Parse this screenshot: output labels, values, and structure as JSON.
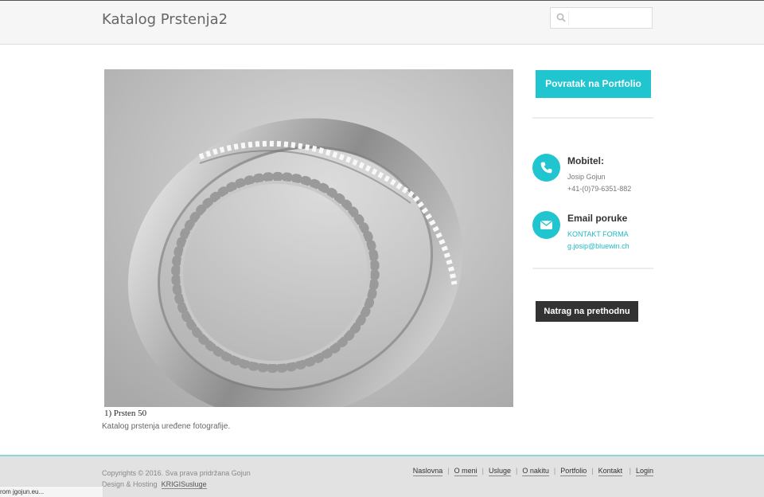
{
  "header": {
    "site_title": "Katalog Prstenja2",
    "search": {
      "placeholder": "",
      "value": "",
      "icon": "search-icon"
    }
  },
  "main": {
    "image_caption": "1) Prsten 50",
    "description": "Katalog prstenja uređene fotografije."
  },
  "sidebar": {
    "portfolio_button": "Povratak na Portfolio",
    "contacts": [
      {
        "icon": "phone-icon",
        "title": "Mobitel:",
        "lines": [
          "Josip Gojun",
          "+41-(0)79-6351-882"
        ]
      },
      {
        "icon": "envelope-icon",
        "title": "Email poruke",
        "lines": [
          "KONTAKT FORMA",
          "g.josip@bluewin.ch"
        ]
      }
    ],
    "back_button": "Natrag na prethodnu"
  },
  "footer": {
    "copyright": "Copyrights © 2016. Sva prava pridržana Gojun Design & Hosting",
    "hosting_link": "KRIGISusluge",
    "nav": [
      "Naslovna",
      "O meni",
      "Usluge",
      "O nakitu",
      "Portfolio",
      "Kontakt",
      "Login"
    ]
  },
  "status_bar": {
    "text": "rom jgojun.eu..."
  },
  "colors": {
    "accent": "#20c5cf",
    "dark_button": "#333333",
    "footer_bg": "#e2e2e2"
  }
}
